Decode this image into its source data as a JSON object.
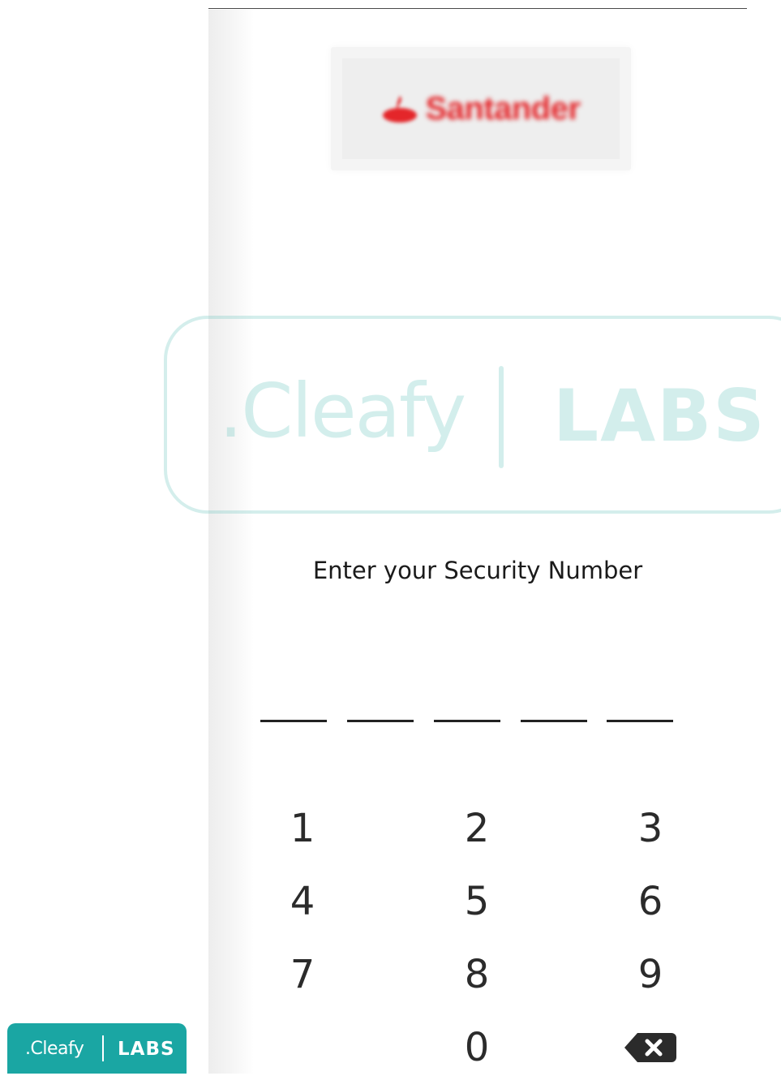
{
  "bank": {
    "name": "Santander",
    "brand_color": "#e4262a"
  },
  "prompt": {
    "title": "Enter your Security Number"
  },
  "pin": {
    "slots": 5,
    "entered": 0
  },
  "keypad": {
    "keys": [
      "1",
      "2",
      "3",
      "4",
      "5",
      "6",
      "7",
      "8",
      "9",
      "0"
    ],
    "backspace_icon": "backspace-icon"
  },
  "watermark": {
    "brand": ".Cleafy",
    "labs": "LABS",
    "color": "#7acbc4"
  },
  "badge": {
    "brand": ".Cleafy",
    "labs": "LABS",
    "color": "#1aa6a3"
  }
}
